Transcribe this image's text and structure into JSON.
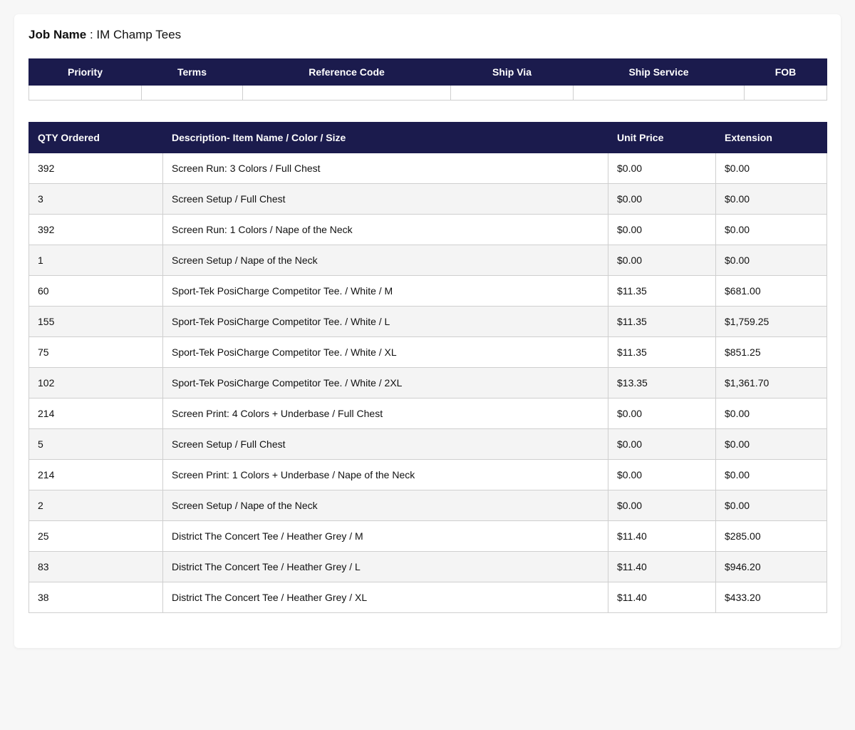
{
  "job": {
    "label": "Job Name",
    "separator": " : ",
    "value": "IM Champ Tees"
  },
  "info_table": {
    "headers": [
      "Priority",
      "Terms",
      "Reference Code",
      "Ship Via",
      "Ship Service",
      "FOB"
    ],
    "values": [
      "",
      "",
      "",
      "",
      "",
      ""
    ]
  },
  "items_table": {
    "headers": [
      "QTY Ordered",
      "Description- Item Name / Color / Size",
      "Unit Price",
      "Extension"
    ],
    "rows": [
      [
        "392",
        "Screen Run: 3 Colors / Full Chest",
        "$0.00",
        "$0.00"
      ],
      [
        "3",
        "Screen Setup / Full Chest",
        "$0.00",
        "$0.00"
      ],
      [
        "392",
        "Screen Run: 1 Colors / Nape of the Neck",
        "$0.00",
        "$0.00"
      ],
      [
        "1",
        "Screen Setup / Nape of the Neck",
        "$0.00",
        "$0.00"
      ],
      [
        "60",
        "Sport-Tek PosiCharge Competitor Tee. / White / M",
        "$11.35",
        "$681.00"
      ],
      [
        "155",
        "Sport-Tek PosiCharge Competitor Tee. / White / L",
        "$11.35",
        "$1,759.25"
      ],
      [
        "75",
        "Sport-Tek PosiCharge Competitor Tee. / White / XL",
        "$11.35",
        "$851.25"
      ],
      [
        "102",
        "Sport-Tek PosiCharge Competitor Tee. / White / 2XL",
        "$13.35",
        "$1,361.70"
      ],
      [
        "214",
        "Screen Print: 4 Colors + Underbase / Full Chest",
        "$0.00",
        "$0.00"
      ],
      [
        "5",
        "Screen Setup / Full Chest",
        "$0.00",
        "$0.00"
      ],
      [
        "214",
        "Screen Print: 1 Colors + Underbase / Nape of the Neck",
        "$0.00",
        "$0.00"
      ],
      [
        "2",
        "Screen Setup / Nape of the Neck",
        "$0.00",
        "$0.00"
      ],
      [
        "25",
        "District The Concert Tee / Heather Grey / M",
        "$11.40",
        "$285.00"
      ],
      [
        "83",
        "District The Concert Tee / Heather Grey / L",
        "$11.40",
        "$946.20"
      ],
      [
        "38",
        "District The Concert Tee / Heather Grey / XL",
        "$11.40",
        "$433.20"
      ]
    ]
  },
  "colors": {
    "header_bg": "#1b1b4d",
    "header_text": "#ffffff",
    "stripe": "#f4f4f4"
  }
}
